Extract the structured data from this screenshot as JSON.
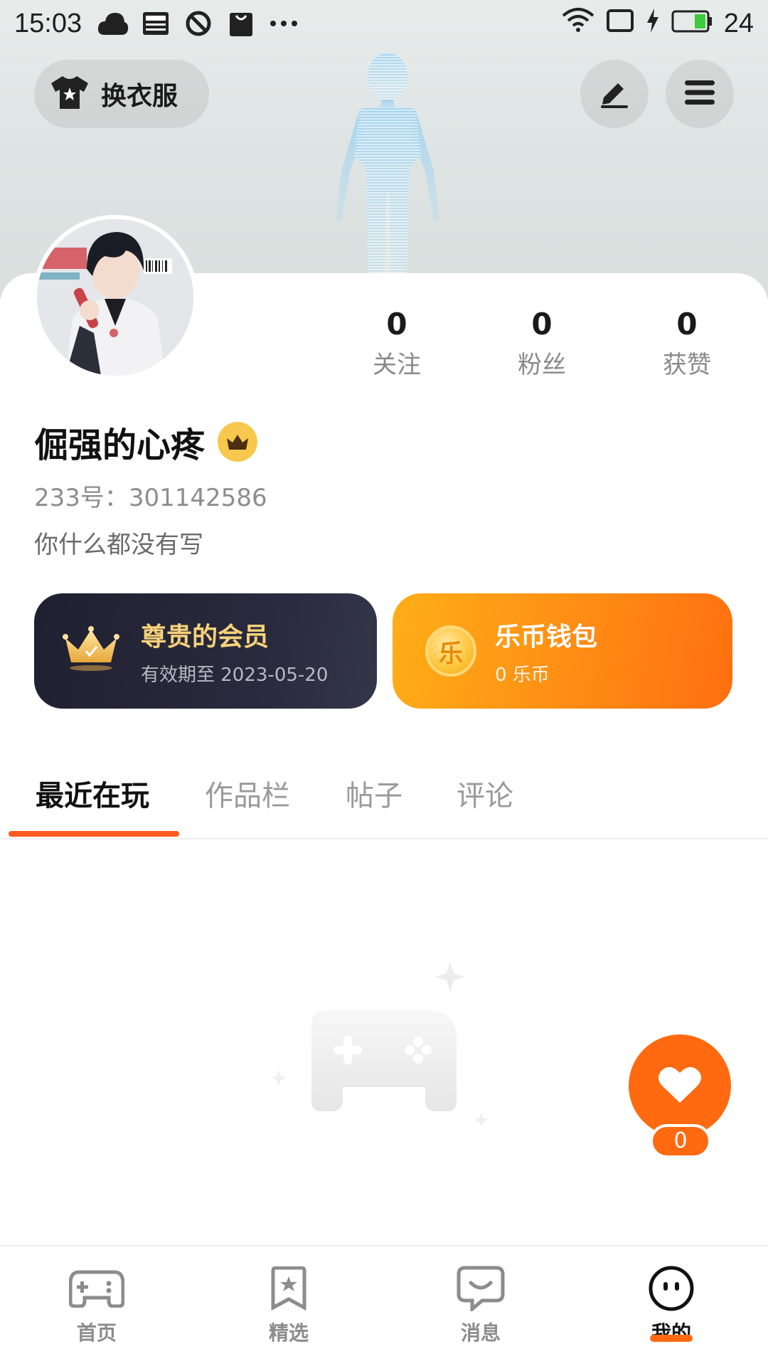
{
  "status_bar": {
    "time": "15:03",
    "left_icons": [
      "cloud-icon",
      "news-icon",
      "blocked-icon",
      "shopping-bag-icon",
      "more-dots-icon"
    ],
    "battery": "24",
    "right_icons": [
      "wifi-icon",
      "screen-rotate-icon",
      "charging-icon",
      "battery-icon"
    ]
  },
  "top_bar": {
    "outfit_label": "换衣服"
  },
  "profile": {
    "username": "倔强的心疼",
    "uid": "233号：301142586",
    "bio": "你什么都没有写",
    "stats": [
      {
        "value": "0",
        "label": "关注"
      },
      {
        "value": "0",
        "label": "粉丝"
      },
      {
        "value": "0",
        "label": "获赞"
      }
    ]
  },
  "vip": {
    "title": "尊贵的会员",
    "subtitle": "有效期至 2023-05-20"
  },
  "wallet": {
    "title": "乐币钱包",
    "subtitle": "0 乐币",
    "coin_symbol": "乐"
  },
  "tabs": [
    {
      "label": "最近在玩",
      "active": true
    },
    {
      "label": "作品栏",
      "active": false
    },
    {
      "label": "帖子",
      "active": false
    },
    {
      "label": "评论",
      "active": false
    }
  ],
  "like_fab": {
    "count": "0"
  },
  "bottom_nav": [
    {
      "label": "首页",
      "icon": "gamepad-icon",
      "active": false
    },
    {
      "label": "精选",
      "icon": "star-bookmark-icon",
      "active": false
    },
    {
      "label": "消息",
      "icon": "message-icon",
      "active": false
    },
    {
      "label": "我的",
      "icon": "face-icon",
      "active": true
    }
  ],
  "colors": {
    "accent": "#ff6a10",
    "vip_gold": "#f7d27a",
    "vip_bg": "#23243a"
  }
}
